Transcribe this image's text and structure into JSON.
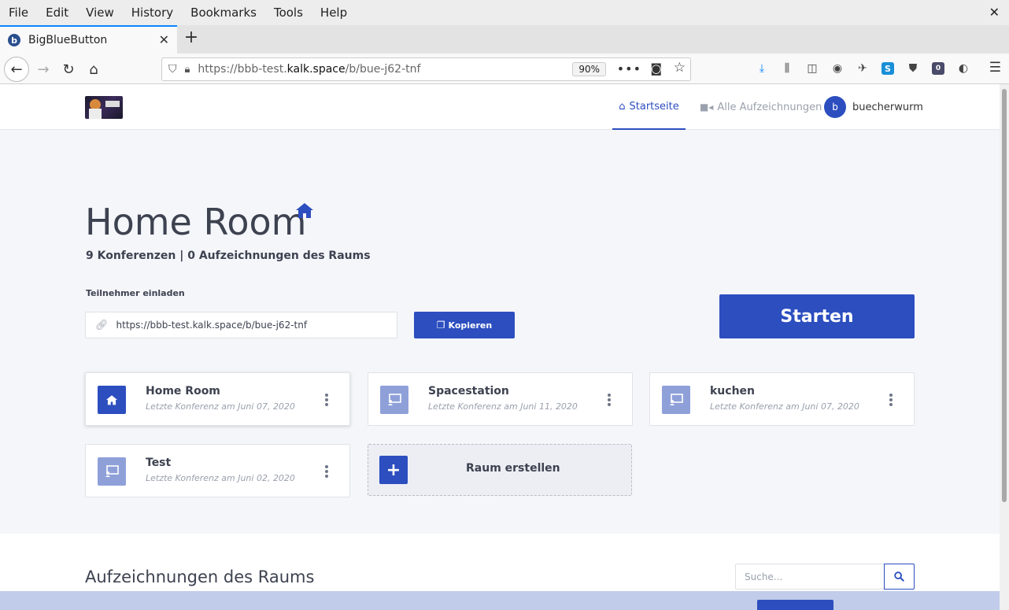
{
  "browser": {
    "menu": [
      "File",
      "Edit",
      "View",
      "History",
      "Bookmarks",
      "Tools",
      "Help"
    ],
    "tab_title": "BigBlueButton",
    "url_prefix": "https://bbb-test.",
    "url_domain": "kalk.space",
    "url_path": "/b/bue-j62-tnf",
    "zoom": "90%",
    "notification_count": "0"
  },
  "header": {
    "nav_home": "Startseite",
    "nav_recordings": "Alle Aufzeichnungen",
    "user_initial": "b",
    "user_name": "buecherwurm"
  },
  "room": {
    "title": "Home Room",
    "stats": "9 Konferenzen | 0 Aufzeichnungen des Raums",
    "invite_label": "Teilnehmer einladen",
    "invite_url": "https://bbb-test.kalk.space/b/bue-j62-tnf",
    "copy_label": "Kopieren",
    "start_label": "Starten"
  },
  "rooms": [
    {
      "name": "Home Room",
      "date": "Letzte Konferenz am Juni 07, 2020",
      "active": true
    },
    {
      "name": "Spacestation",
      "date": "Letzte Konferenz am Juni 11, 2020",
      "active": false
    },
    {
      "name": "kuchen",
      "date": "Letzte Konferenz am Juni 07, 2020",
      "active": false
    },
    {
      "name": "Test",
      "date": "Letzte Konferenz am Juni 02, 2020",
      "active": false
    }
  ],
  "create_room_label": "Raum erstellen",
  "recordings": {
    "title": "Aufzeichnungen des Raums",
    "search_placeholder": "Suche..."
  },
  "colors": {
    "accent": "#2c4ebf",
    "card_icon_inactive": "#8fa0d9",
    "text": "#3d4250",
    "muted": "#9aa0ac"
  }
}
